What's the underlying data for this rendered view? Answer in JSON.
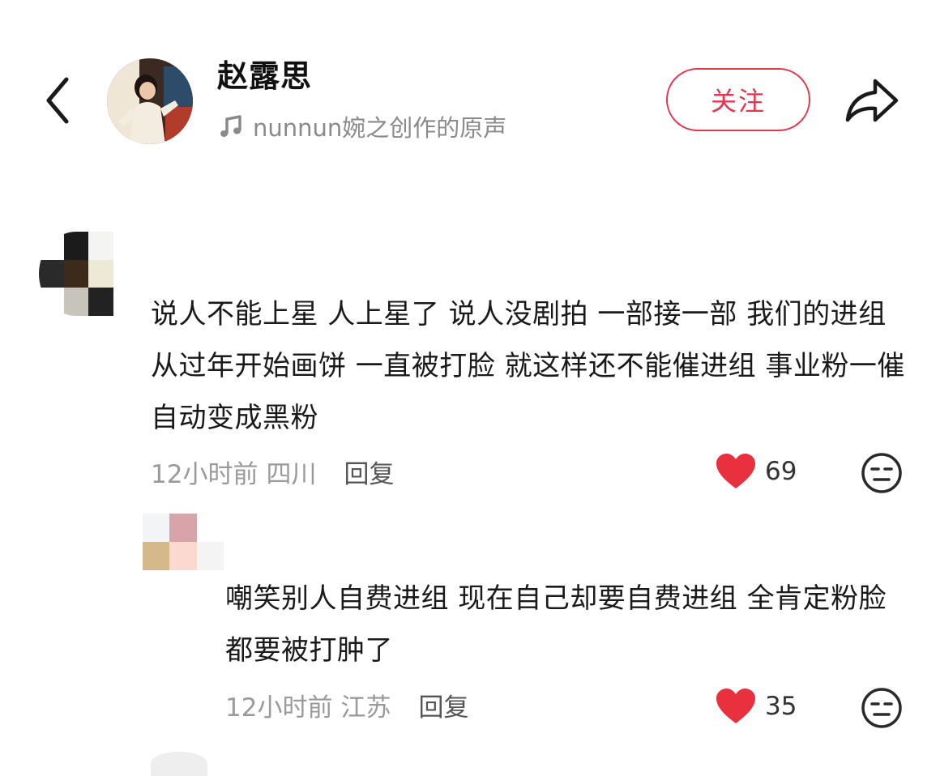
{
  "header": {
    "author_name": "赵露思",
    "music_label": "nunnun婉之创作的原声",
    "follow_label": "关注",
    "icons": {
      "back": "chevron-left-icon",
      "music": "music-note-icon",
      "share": "share-arrow-icon"
    }
  },
  "comments": [
    {
      "text": "说人不能上星 人上星了 说人没剧拍 一部接一部 我们的进组从过年开始画饼 一直被打脸 就这样还不能催进组 事业粉一催自动变成黑粉",
      "time": "12小时前",
      "location": "四川",
      "reply_label": "回复",
      "likes": "69"
    },
    {
      "text": "嘲笑别人自费进组 现在自己却要自费进组 全肯定粉脸都要被打肿了",
      "time": "12小时前",
      "location": "江苏",
      "reply_label": "回复",
      "likes": "35"
    }
  ],
  "colors": {
    "accent": "#e0384f",
    "heart": "#e8303f",
    "meta_text": "#9a9a9a"
  }
}
